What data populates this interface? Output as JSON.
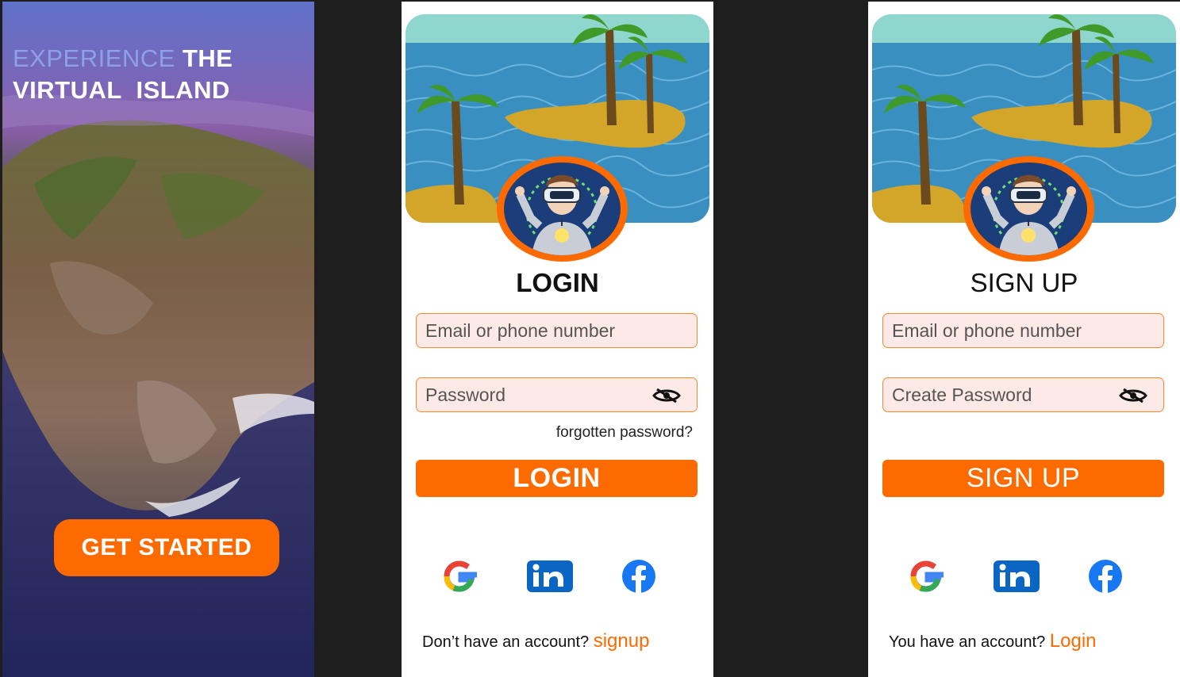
{
  "splash": {
    "title_word1": "EXPERIENCE",
    "title_word2": "THE",
    "title_line2": "VIRTUAL  ISLAND",
    "cta_label": "GET STARTED"
  },
  "login": {
    "heading": "LOGIN",
    "email_placeholder": "Email or phone number",
    "password_placeholder": "Password",
    "forgot_label": "forgotten password?",
    "cta_label": "LOGIN",
    "footer_text": "Don’t have an account?",
    "footer_link": "signup",
    "social": [
      "google-icon",
      "linkedin-icon",
      "facebook-icon"
    ]
  },
  "signup": {
    "heading": "SIGN UP",
    "email_placeholder": "Email or phone number",
    "password_placeholder": "Create Password",
    "cta_label": "SIGN UP",
    "footer_text": "You have an account?",
    "footer_link": "Login",
    "social": [
      "google-icon",
      "linkedin-icon",
      "facebook-icon"
    ]
  },
  "colors": {
    "accent": "#fd6a00",
    "field_bg": "#fde9e6",
    "field_border": "#f7882f",
    "canvas": "#1e1e1e"
  }
}
